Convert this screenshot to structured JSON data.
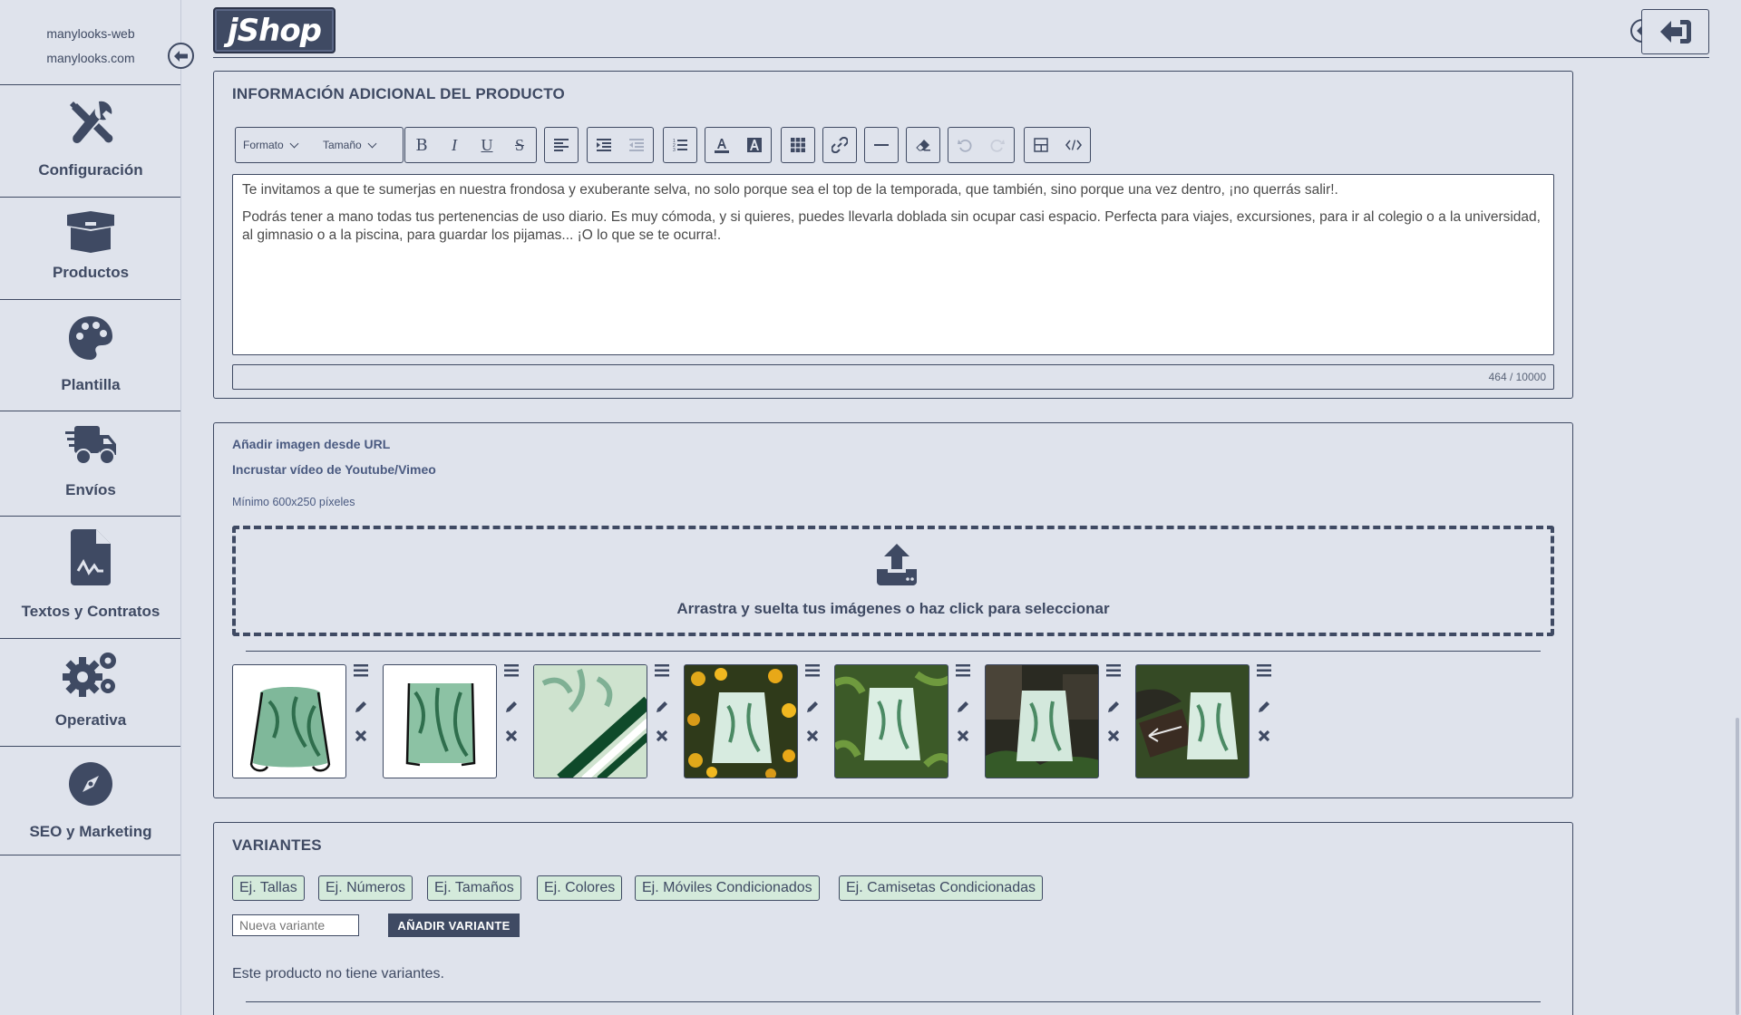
{
  "site": {
    "name": "manylooks-web",
    "domain": "manylooks.com"
  },
  "sidebar": {
    "items": [
      {
        "label": "Configuración",
        "icon": "tools-icon"
      },
      {
        "label": "Productos",
        "icon": "box-icon"
      },
      {
        "label": "Plantilla",
        "icon": "palette-icon"
      },
      {
        "label": "Envíos",
        "icon": "truck-icon"
      },
      {
        "label": "Textos y Contratos",
        "icon": "contract-icon"
      },
      {
        "label": "Operativa",
        "icon": "gears-icon"
      },
      {
        "label": "SEO y Marketing",
        "icon": "compass-icon"
      }
    ]
  },
  "header": {
    "logo": "jShop"
  },
  "info_panel": {
    "title": "INFORMACIÓN ADICIONAL DEL PRODUCTO",
    "format_select": "Formato",
    "size_select": "Tamaño",
    "paragraphs": [
      "Te invitamos a que te sumerjas en nuestra frondosa y exuberante selva, no solo porque sea el top de la temporada, que también, sino porque una vez dentro, ¡no querrás salir!.",
      "Podrás tener a mano todas tus pertenencias de uso diario. Es muy cómoda, y si quieres, puedes llevarla doblada sin ocupar casi espacio. Perfecta para viajes, excursiones, para ir al colegio o a la universidad, al gimnasio o a la piscina, para guardar los pijamas... ¡O lo que se te ocurra!."
    ],
    "char_count": "464 / 10000"
  },
  "images_panel": {
    "add_from_url": "Añadir imagen desde URL",
    "embed_video": "Incrustar vídeo de Youtube/Vimeo",
    "min_size": "Mínimo 600x250 píxeles",
    "dropzone_text": "Arrastra y suelta tus imágenes o haz click para seleccionar",
    "images": [
      {
        "bg": "#ffffff"
      },
      {
        "bg": "#ffffff"
      },
      {
        "bg": "#e6efe3"
      },
      {
        "bg": "#2f3a1a"
      },
      {
        "bg": "#3c5a28"
      },
      {
        "bg": "#2a2a22"
      },
      {
        "bg": "#354a25"
      }
    ]
  },
  "variants_panel": {
    "title": "VARIANTES",
    "chips": [
      "Ej. Tallas",
      "Ej. Números",
      "Ej. Tamaños",
      "Ej. Colores",
      "Ej. Móviles Condicionados",
      "Ej. Camisetas Condicionadas"
    ],
    "new_variant_placeholder": "Nueva variante",
    "add_button": "AÑADIR VARIANTE",
    "empty_text": "Este producto no tiene variantes."
  },
  "colors": {
    "primary": "#3f4a63",
    "background": "#dfe3ec",
    "chip": "#d4eadb"
  }
}
